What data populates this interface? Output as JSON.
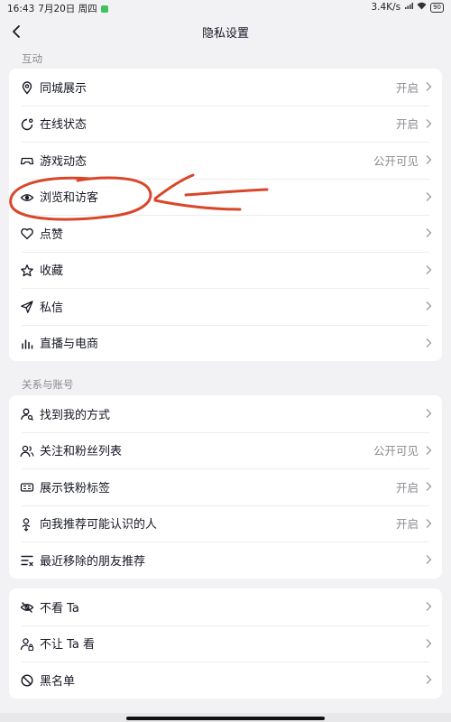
{
  "status_bar": {
    "time": "16:43",
    "date": "7月20日 周四",
    "network_speed": "3.4K/s",
    "battery": "90"
  },
  "nav": {
    "title": "隐私设置"
  },
  "sections": [
    {
      "label": "互动",
      "items": [
        {
          "label": "同城展示",
          "value": "开启",
          "icon": "location-icon"
        },
        {
          "label": "在线状态",
          "value": "开启",
          "icon": "online-status-icon"
        },
        {
          "label": "游戏动态",
          "value": "公开可见",
          "icon": "gamepad-icon"
        },
        {
          "label": "浏览和访客",
          "value": "",
          "icon": "eye-icon"
        },
        {
          "label": "点赞",
          "value": "",
          "icon": "heart-icon"
        },
        {
          "label": "收藏",
          "value": "",
          "icon": "star-icon"
        },
        {
          "label": "私信",
          "value": "",
          "icon": "send-icon"
        },
        {
          "label": "直播与电商",
          "value": "",
          "icon": "live-bars-icon"
        }
      ]
    },
    {
      "label": "关系与账号",
      "items": [
        {
          "label": "找到我的方式",
          "value": "",
          "icon": "find-user-icon"
        },
        {
          "label": "关注和粉丝列表",
          "value": "公开可见",
          "icon": "users-icon"
        },
        {
          "label": "展示铁粉标签",
          "value": "开启",
          "icon": "fan-badge-icon"
        },
        {
          "label": "向我推荐可能认识的人",
          "value": "开启",
          "icon": "recommend-user-icon"
        },
        {
          "label": "最近移除的朋友推荐",
          "value": "",
          "icon": "remove-list-icon"
        }
      ]
    },
    {
      "label": "",
      "items": [
        {
          "label": "不看 Ta",
          "value": "",
          "icon": "eye-off-icon"
        },
        {
          "label": "不让 Ta 看",
          "value": "",
          "icon": "user-lock-icon"
        },
        {
          "label": "黑名单",
          "value": "",
          "icon": "block-icon"
        }
      ]
    }
  ],
  "colors": {
    "background": "#f2f2f4",
    "card": "#ffffff",
    "annotation": "#d9472b",
    "secondary_text": "#8a8b91"
  }
}
